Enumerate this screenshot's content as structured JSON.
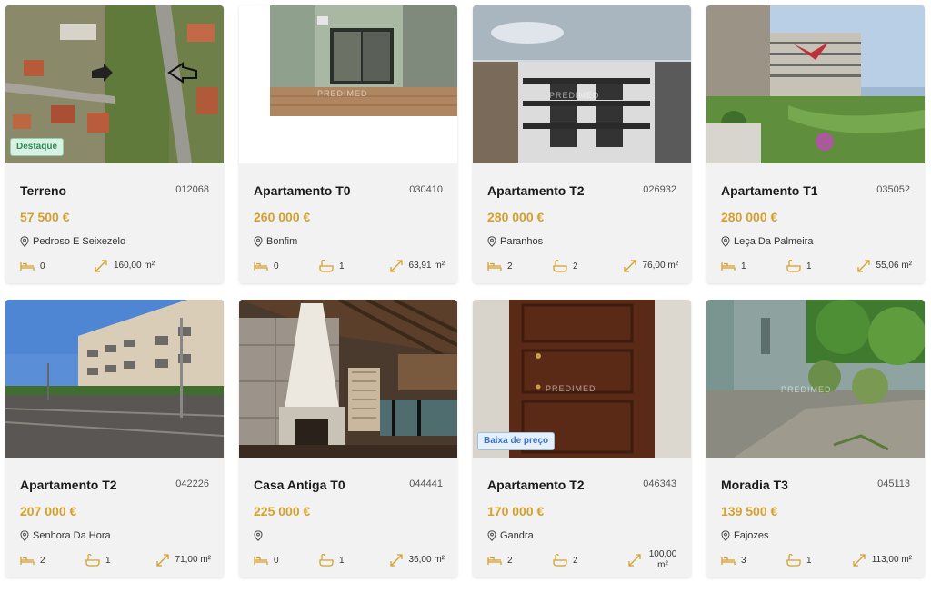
{
  "accent_color": "#d4a12e",
  "listings": [
    {
      "title": "Terreno",
      "ref": "012068",
      "price": "57 500 €",
      "location": "Pedroso E Seixezelo",
      "bedrooms": "0",
      "bathrooms": null,
      "area": "160,00 m²",
      "badge": "Destaque"
    },
    {
      "title": "Apartamento T0",
      "ref": "030410",
      "price": "260 000 €",
      "location": "Bonfim",
      "bedrooms": "0",
      "bathrooms": "1",
      "area": "63,91 m²",
      "badge": null
    },
    {
      "title": "Apartamento T2",
      "ref": "026932",
      "price": "280 000 €",
      "location": "Paranhos",
      "bedrooms": "2",
      "bathrooms": "2",
      "area": "76,00 m²",
      "badge": null
    },
    {
      "title": "Apartamento T1",
      "ref": "035052",
      "price": "280 000 €",
      "location": "Leça Da Palmeira",
      "bedrooms": "1",
      "bathrooms": "1",
      "area": "55,06 m²",
      "badge": null
    },
    {
      "title": "Apartamento T2",
      "ref": "042226",
      "price": "207 000 €",
      "location": "Senhora Da Hora",
      "bedrooms": "2",
      "bathrooms": "1",
      "area": "71,00 m²",
      "badge": null
    },
    {
      "title": "Casa Antiga T0",
      "ref": "044441",
      "price": "225 000 €",
      "location": "",
      "bedrooms": "0",
      "bathrooms": "1",
      "area": "36,00 m²",
      "badge": null
    },
    {
      "title": "Apartamento T2",
      "ref": "046343",
      "price": "170 000 €",
      "location": "Gandra",
      "bedrooms": "2",
      "bathrooms": "2",
      "area": "100,00 m²",
      "badge": "Baixa de preço"
    },
    {
      "title": "Moradia T3",
      "ref": "045113",
      "price": "139 500 €",
      "location": "Fajozes",
      "bedrooms": "3",
      "bathrooms": "1",
      "area": "113,00 m²",
      "badge": null
    }
  ],
  "watermark": "PREDIMED"
}
